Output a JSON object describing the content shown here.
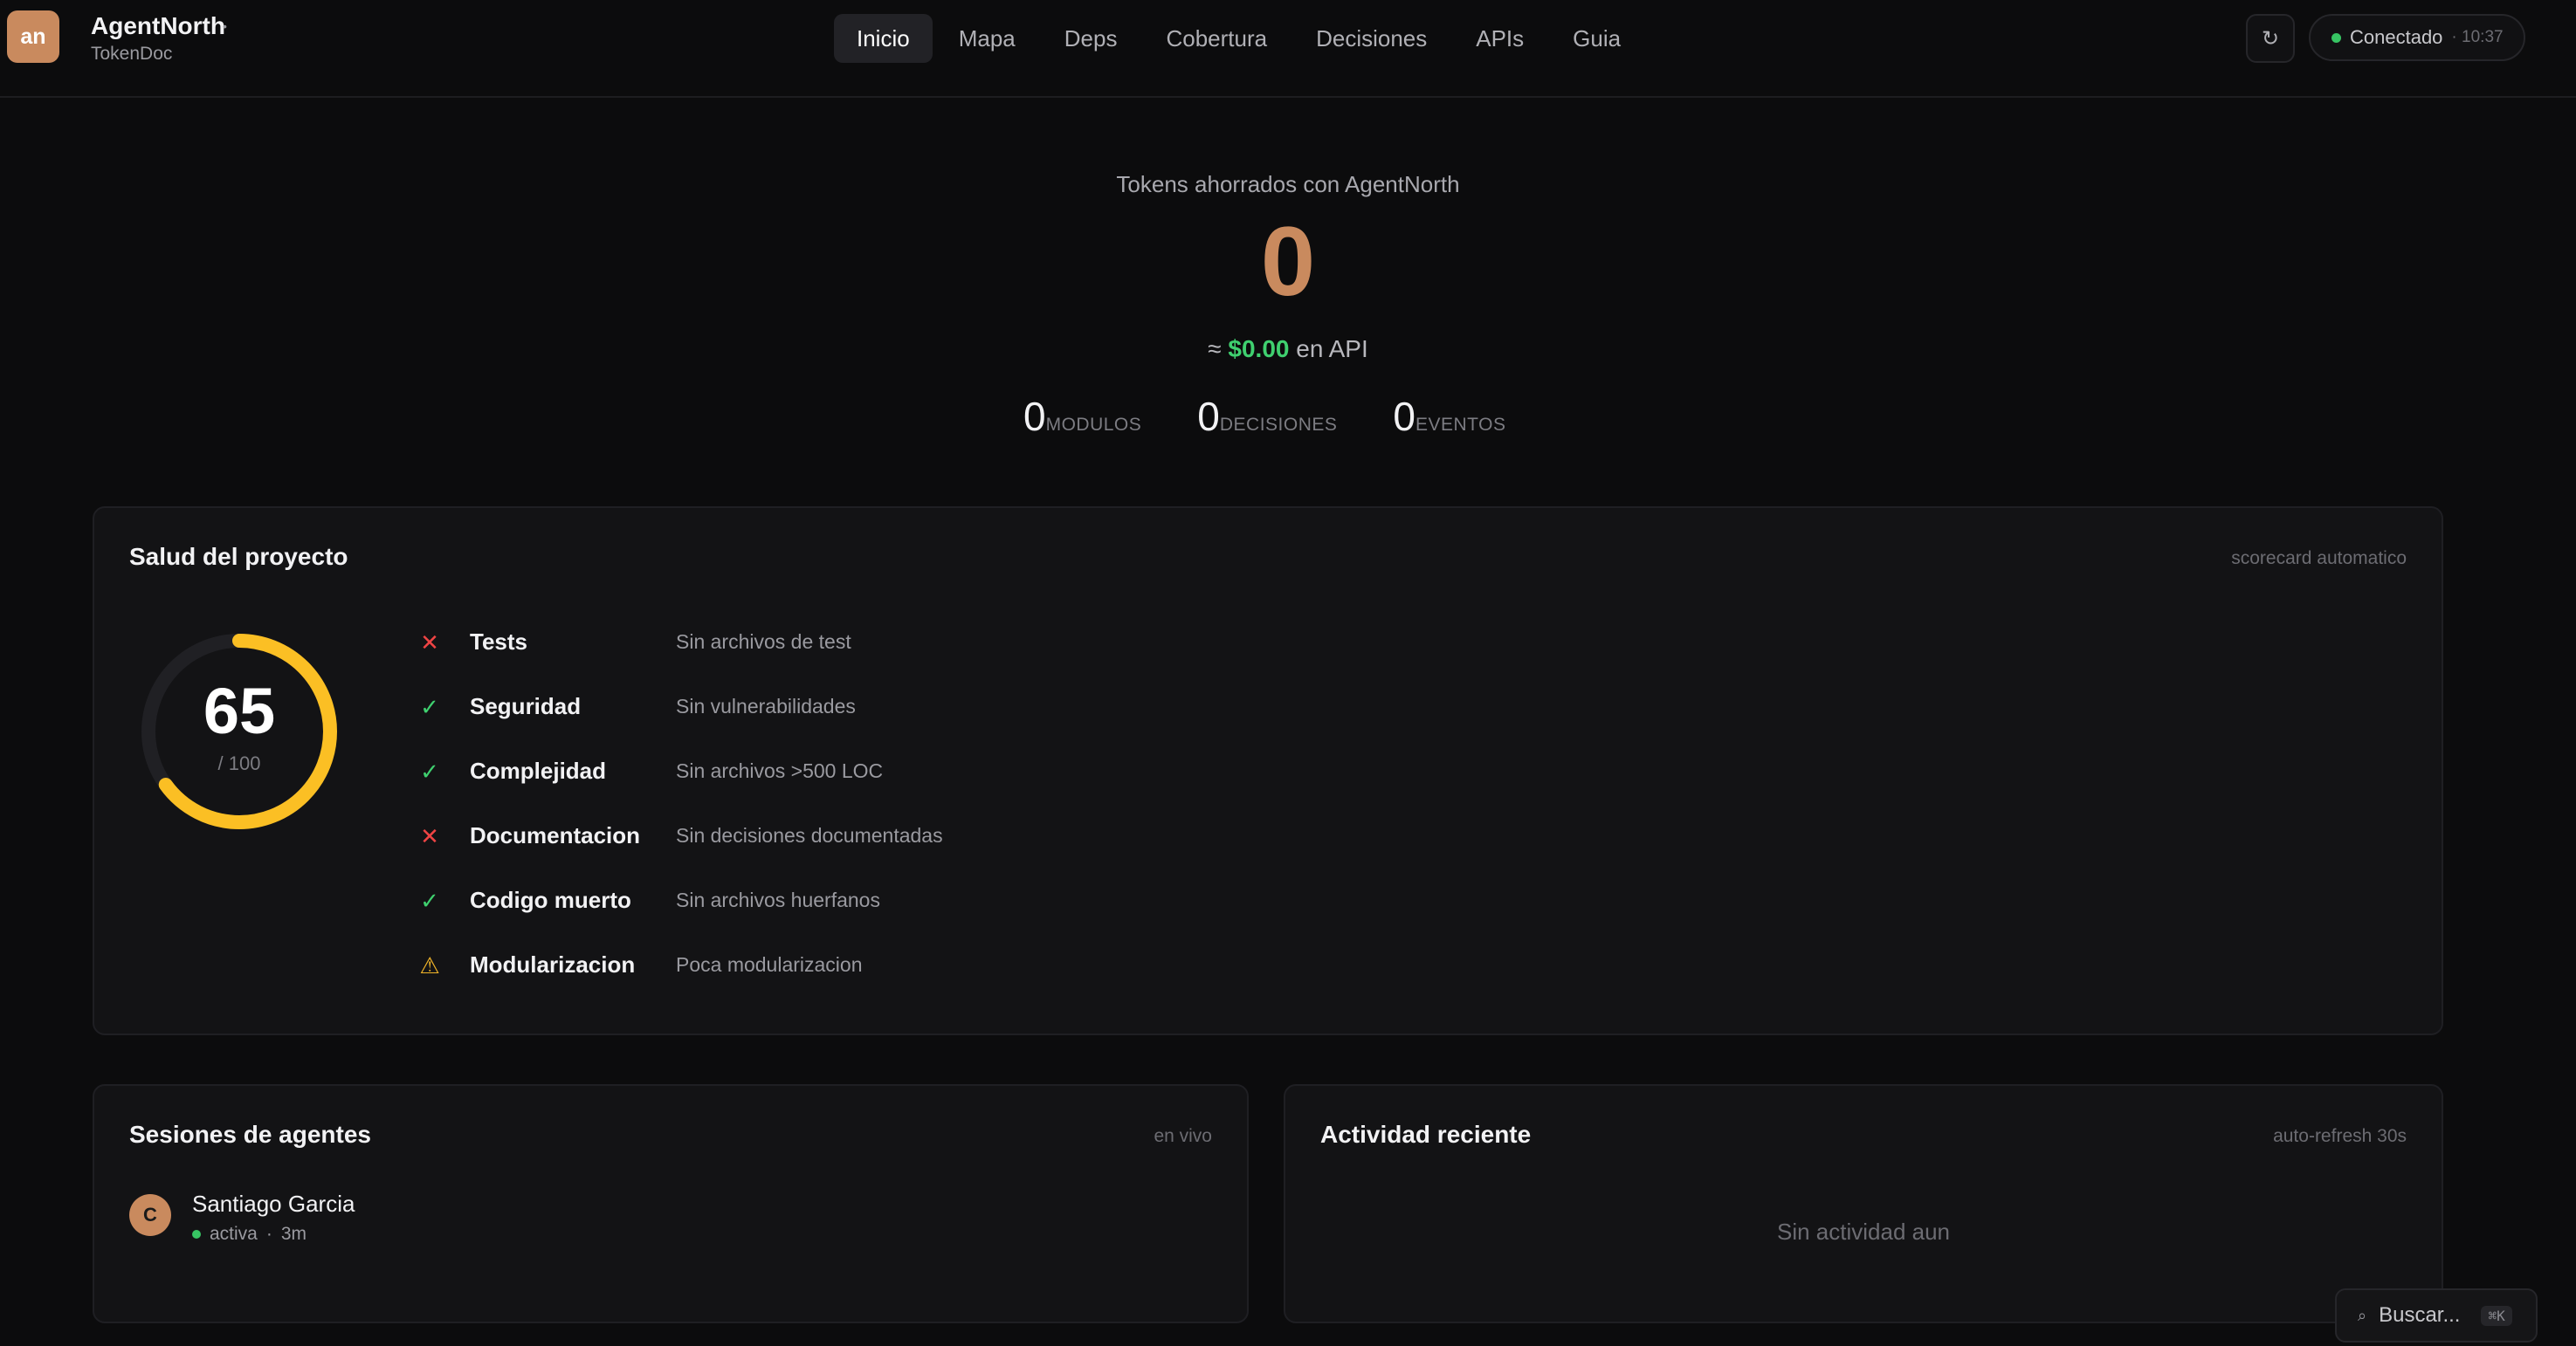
{
  "header": {
    "logo_text": "an",
    "app_name": "AgentNorth",
    "app_marker": "•",
    "project_name": "TokenDoc",
    "nav": [
      {
        "label": "Inicio",
        "active": true
      },
      {
        "label": "Mapa"
      },
      {
        "label": "Deps"
      },
      {
        "label": "Cobertura"
      },
      {
        "label": "Decisiones"
      },
      {
        "label": "APIs"
      },
      {
        "label": "Guia"
      }
    ],
    "refresh_icon": "↻",
    "status": {
      "label": "Conectado",
      "time": "· 10:37",
      "color": "#37c463"
    }
  },
  "hero": {
    "label": "Tokens ahorrados con AgentNorth",
    "value": "0",
    "cost_prefix": "≈ ",
    "cost_amount": "$0.00",
    "cost_suffix": " en API",
    "stats": [
      {
        "value": "0",
        "label": "MODULOS"
      },
      {
        "value": "0",
        "label": "DECISIONES"
      },
      {
        "value": "0",
        "label": "EVENTOS"
      }
    ]
  },
  "health": {
    "title": "Salud del proyecto",
    "meta": "scorecard automatico",
    "score": "65",
    "score_max": "/ 100",
    "score_fraction": 0.65,
    "gauge_color": "#fbbf24",
    "checks": [
      {
        "status": "fail",
        "icon": "✕",
        "name": "Tests",
        "desc": "Sin archivos de test"
      },
      {
        "status": "pass",
        "icon": "✓",
        "name": "Seguridad",
        "desc": "Sin vulnerabilidades"
      },
      {
        "status": "pass",
        "icon": "✓",
        "name": "Complejidad",
        "desc": "Sin archivos >500 LOC"
      },
      {
        "status": "fail",
        "icon": "✕",
        "name": "Documentacion",
        "desc": "Sin decisiones documentadas"
      },
      {
        "status": "pass",
        "icon": "✓",
        "name": "Codigo muerto",
        "desc": "Sin archivos huerfanos"
      },
      {
        "status": "warn",
        "icon": "⚠",
        "name": "Modularizacion",
        "desc": "Poca modularizacion"
      }
    ]
  },
  "sessions": {
    "title": "Sesiones de agentes",
    "meta": "en vivo",
    "items": [
      {
        "initial": "C",
        "name": "Santiago Garcia",
        "state": "activa",
        "sep": "·",
        "duration": "3m"
      }
    ]
  },
  "activity": {
    "title": "Actividad reciente",
    "meta": "auto-refresh 30s",
    "empty": "Sin actividad aun"
  },
  "search": {
    "icon": "⌕",
    "label": "Buscar...",
    "shortcut": "⌘K"
  }
}
